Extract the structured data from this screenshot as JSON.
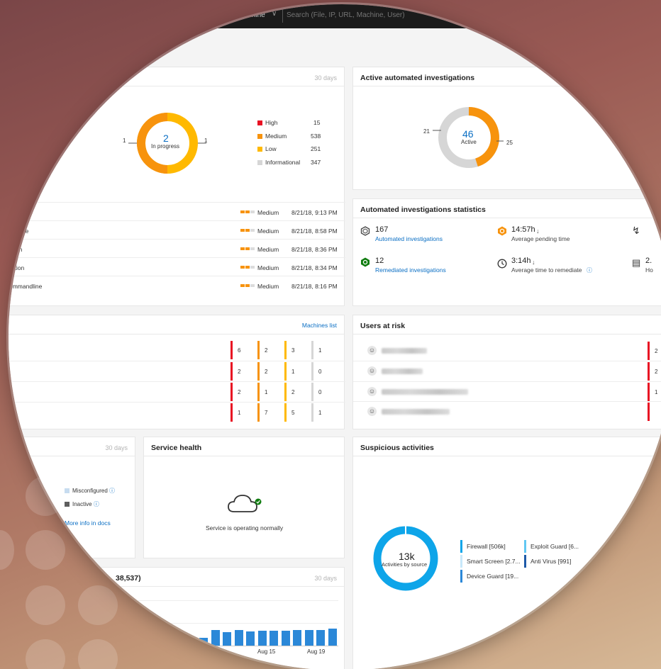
{
  "topbar": {
    "machine_selector": "Machine",
    "search_placeholder": "Search (File, IP, URL, Machine, User)"
  },
  "alerts_card": {
    "days": "30 days",
    "donut": {
      "value": "2",
      "label": "In progress",
      "left_count": "1",
      "right_count": "1"
    },
    "legend": [
      {
        "label": "High",
        "count": "15",
        "color": "#e81123"
      },
      {
        "label": "Medium",
        "count": "538",
        "color": "#f7930d"
      },
      {
        "label": "Low",
        "count": "251",
        "color": "#ffb900"
      },
      {
        "label": "Informational",
        "count": "347",
        "color": "#d6d6d6"
      }
    ],
    "rows": [
      {
        "name": "ndline",
        "severity": "Medium",
        "time": "8/21/18, 9:13 PM"
      },
      {
        "name": "andline",
        "severity": "Medium",
        "time": "8/21/18, 8:58 PM"
      },
      {
        "name": "ation",
        "severity": "Medium",
        "time": "8/21/18, 8:36 PM"
      },
      {
        "name": "ration",
        "severity": "Medium",
        "time": "8/21/18, 8:34 PM"
      },
      {
        "name": "ommandline",
        "severity": "Medium",
        "time": "8/21/18, 8:16 PM"
      }
    ]
  },
  "active_investigations": {
    "title": "Active automated investigations",
    "donut": {
      "value": "46",
      "label": "Active",
      "left_count": "21",
      "right_count": "25"
    }
  },
  "stats": {
    "title": "Automated investigations statistics",
    "items": [
      {
        "value": "167",
        "label": "Automated investigations",
        "icon": "hexagon-outline-icon"
      },
      {
        "value": "14:57h",
        "label": "Average pending time",
        "icon": "hourglass-hex-icon"
      },
      {
        "value": "12",
        "label": "Remediated investigations",
        "icon": "shield-check-hex-icon"
      },
      {
        "value": "3:14h",
        "label": "Average time to remediate",
        "icon": "clock-icon"
      }
    ],
    "partial_third_col": [
      {
        "value": "",
        "label": "",
        "icon": "lightning-icon"
      },
      {
        "value": "2.",
        "label": "Ho",
        "icon": "report-clock-icon"
      }
    ]
  },
  "machines_card": {
    "link": "Machines list",
    "rows": [
      {
        "high": "6",
        "medium": "2",
        "low": "3",
        "info": "1"
      },
      {
        "high": "2",
        "medium": "2",
        "low": "1",
        "info": "0"
      },
      {
        "high": "2",
        "medium": "1",
        "low": "2",
        "info": "0"
      },
      {
        "high": "1",
        "medium": "7",
        "low": "5",
        "info": "1"
      }
    ]
  },
  "users_card": {
    "title": "Users at risk",
    "right_counts": [
      "2",
      "2",
      "1",
      ""
    ]
  },
  "sensor_card": {
    "days": "30 days",
    "legend": [
      {
        "label": "Misconfigured",
        "color": "#c7dcf0"
      },
      {
        "label": "Inactive",
        "color": "#5e5e5e"
      }
    ],
    "link": "More info in docs"
  },
  "service_health": {
    "title": "Service health",
    "status": "Service is operating normally"
  },
  "machine_reporting": {
    "title_fragment": "38,537)",
    "days": "30 days",
    "x_labels": [
      "Aug 15",
      "Aug 19"
    ],
    "chart_data": {
      "type": "bar",
      "values": [
        0.45,
        0.9,
        0.8,
        0.9,
        0.82,
        0.88,
        0.88,
        0.88,
        0.9,
        0.9,
        0.9,
        1.0
      ],
      "x_tick_labels": [
        "Aug 15",
        "Aug 19"
      ],
      "color": "#2b88d8"
    }
  },
  "suspicious_card": {
    "title": "Suspicious activities",
    "donut": {
      "value": "13k",
      "label": "Activities by source"
    },
    "legend": [
      {
        "label": "Firewall [506k]",
        "color": "#0ea5e9"
      },
      {
        "label": "Exploit Guard [6...",
        "color": "#61c7f2"
      },
      {
        "label": "Smart Screen [2.7...",
        "color": "#c7e8fa"
      },
      {
        "label": "Anti Virus [991]",
        "color": "#1e5aa8"
      },
      {
        "label": "Device Guard [19...",
        "color": "#2b88d8"
      }
    ]
  }
}
